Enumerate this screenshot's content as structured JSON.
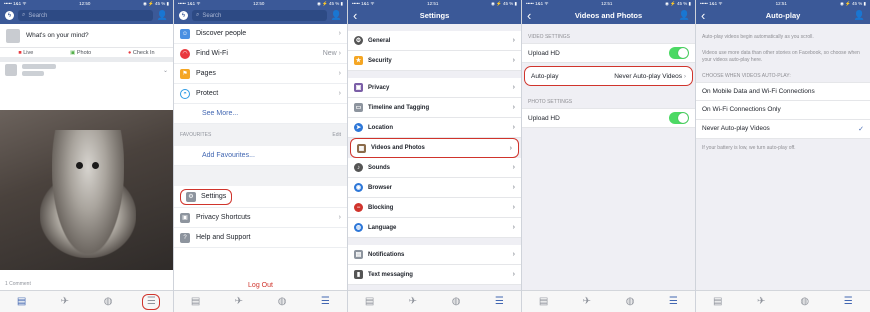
{
  "screens": [
    {
      "status": {
        "carrier": "••••• 1&1 ᯤ",
        "time": "12:50",
        "battery": "◉ ⚡ 45 % ▮"
      },
      "search_placeholder": "Search",
      "composer_prompt": "What's on your mind?",
      "actions": [
        "Live",
        "Photo",
        "Check In"
      ],
      "comments": "1 Comment"
    },
    {
      "status": {
        "carrier": "••••• 1&1 ᯤ",
        "time": "12:50",
        "battery": "◉ ⚡ 45 % ▮"
      },
      "search_placeholder": "Search",
      "items": [
        {
          "label": "Discover people",
          "extra": ""
        },
        {
          "label": "Find Wi-Fi",
          "extra": "New"
        },
        {
          "label": "Pages",
          "extra": ""
        },
        {
          "label": "Protect",
          "extra": ""
        }
      ],
      "see_more": "See More...",
      "favourites_header": "FAVOURITES",
      "favourites_edit": "Edit",
      "add_favourites": "Add Favourites...",
      "bottom_items": [
        "Settings",
        "Privacy Shortcuts",
        "Help and Support"
      ],
      "logout": "Log Out"
    },
    {
      "status": {
        "carrier": "••••• 1&1 ᯤ",
        "time": "12:51",
        "battery": "◉ ⚡ 45 % ▮"
      },
      "title": "Settings",
      "items": [
        "General",
        "Security",
        "Privacy",
        "Timeline and Tagging",
        "Location",
        "Videos and Photos",
        "Sounds",
        "Browser",
        "Blocking",
        "Language",
        "Notifications",
        "Text messaging"
      ]
    },
    {
      "status": {
        "carrier": "••••• 1&1 ᯤ",
        "time": "12:51",
        "battery": "◉ ⚡ 45 % ▮"
      },
      "title": "Videos and Photos",
      "video_header": "VIDEO SETTINGS",
      "upload_hd": "Upload HD",
      "autoplay_label": "Auto-play",
      "autoplay_value": "Never Auto-play Videos",
      "photo_header": "PHOTO SETTINGS",
      "photo_upload_hd": "Upload HD"
    },
    {
      "status": {
        "carrier": "••••• 1&1 ᯤ",
        "time": "12:51",
        "battery": "◉ ⚡ 45 % ▮"
      },
      "title": "Auto-play",
      "note1": "Auto-play videos begin automatically as you scroll.",
      "note2": "Videos use more data than other stories on Facebook, so choose when your videos auto-play here.",
      "choose_header": "CHOOSE WHEN VIDEOS AUTO-PLAY:",
      "options": [
        "On Mobile Data and Wi-Fi Connections",
        "On Wi-Fi Connections Only",
        "Never Auto-play Videos"
      ],
      "battery_note": "If your battery is low, we turn auto-play off."
    }
  ],
  "colors": {
    "brand": "#3b5998",
    "highlight": "#d0342c",
    "toggle": "#4cd964"
  }
}
